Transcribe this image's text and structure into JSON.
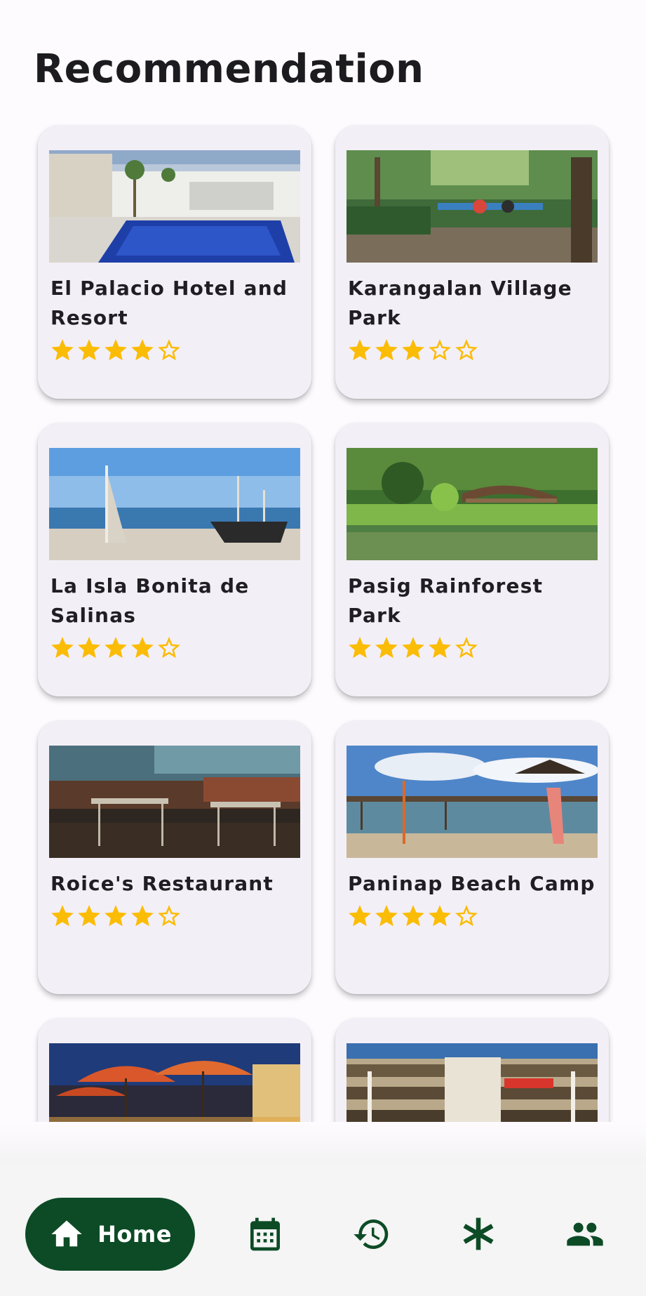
{
  "header": {
    "title": "Recommendation"
  },
  "colors": {
    "accent": "#0c4b26",
    "star": "#fbbc05",
    "card": "#f3eff6"
  },
  "places": [
    {
      "name": "El Palacio Hotel and Resort",
      "rating": 4,
      "max_rating": 5,
      "image": "hotel-pool"
    },
    {
      "name": "Karangalan Village Park",
      "rating": 3,
      "max_rating": 5,
      "image": "park-playground"
    },
    {
      "name": "La Isla Bonita de Salinas",
      "rating": 4,
      "max_rating": 5,
      "image": "beach-boat"
    },
    {
      "name": "Pasig Rainforest Park",
      "rating": 4,
      "max_rating": 5,
      "image": "rainforest-bridge"
    },
    {
      "name": "Roice's Restaurant",
      "rating": 4,
      "max_rating": 5,
      "image": "restaurant-interior"
    },
    {
      "name": "Paninap Beach Camp",
      "rating": 4,
      "max_rating": 5,
      "image": "beach-pier"
    },
    {
      "name": "",
      "rating": 0,
      "max_rating": 0,
      "image": "outdoor-umbrellas"
    },
    {
      "name": "",
      "rating": 0,
      "max_rating": 0,
      "image": "mall-atrium"
    }
  ],
  "nav": {
    "home_label": "Home",
    "icons": [
      "home-icon",
      "calendar-icon",
      "history-icon",
      "asterisk-icon",
      "people-icon"
    ]
  }
}
